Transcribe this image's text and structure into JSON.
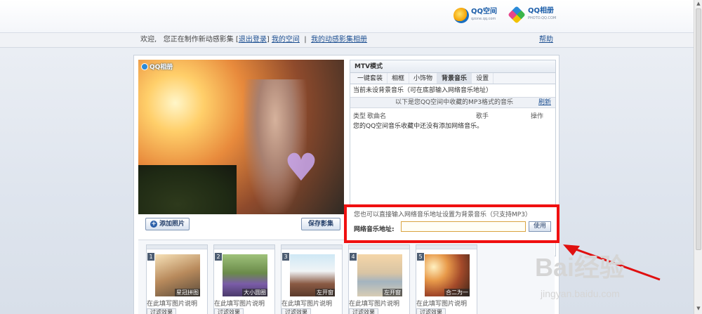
{
  "header": {
    "logo_qzone": "QQ空间",
    "logo_qzone_sub": "qzone.qq.com",
    "logo_photo": "QQ相册",
    "logo_photo_sub": "PHOTO.QQ.COM"
  },
  "nav": {
    "welcome": "欢迎,",
    "making": "您正在制作新动感影集",
    "logout": "退出登录",
    "my_space": "我的空间",
    "my_albums": "我的动感影集相册",
    "help": "帮助"
  },
  "preview": {
    "badge": "QQ相册"
  },
  "buttons": {
    "add_photo": "添加照片",
    "save_album": "保存影集"
  },
  "music": {
    "title": "MTV模式",
    "tabs": [
      {
        "label": "一键套装"
      },
      {
        "label": "相框"
      },
      {
        "label": "小饰物"
      },
      {
        "label": "背景音乐",
        "active": true
      },
      {
        "label": "设置"
      }
    ],
    "status": "当前未设背景音乐（可在底部输入网络音乐地址）",
    "list_bar": "以下是您QQ空间中收藏的MP3格式的音乐",
    "refresh": "刷新",
    "col_type": "类型",
    "col_song": "歌曲名",
    "col_singer": "歌手",
    "col_op": "操作",
    "empty": "您的QQ空间音乐收藏中还没有添加网络音乐。"
  },
  "url_box": {
    "hint": "您也可以直接输入网络音乐地址设置为背景音乐（只支持MP3）",
    "label": "网络音乐地址:",
    "value": "",
    "use": "使用"
  },
  "thumbnails": [
    {
      "num": "1",
      "caption": "星冠拼图",
      "desc": "在此填写图片说明",
      "effect": "过滤效果"
    },
    {
      "num": "2",
      "caption": "大小圆圈",
      "desc": "在此填写图片说明",
      "effect": "过滤效果"
    },
    {
      "num": "3",
      "caption": "左开窗",
      "desc": "在此填写图片说明",
      "effect": "过滤效果"
    },
    {
      "num": "4",
      "caption": "左开窗",
      "desc": "在此填写图片说明",
      "effect": "过滤效果"
    },
    {
      "num": "5",
      "caption": "合二为一",
      "desc": "在此填写图片说明",
      "effect": "过滤效果"
    }
  ],
  "watermark": {
    "brand": "Bai经验",
    "url": "jingyan.baidu.com"
  },
  "colors": {
    "highlight": "#f01010",
    "link": "#1d4f91"
  }
}
